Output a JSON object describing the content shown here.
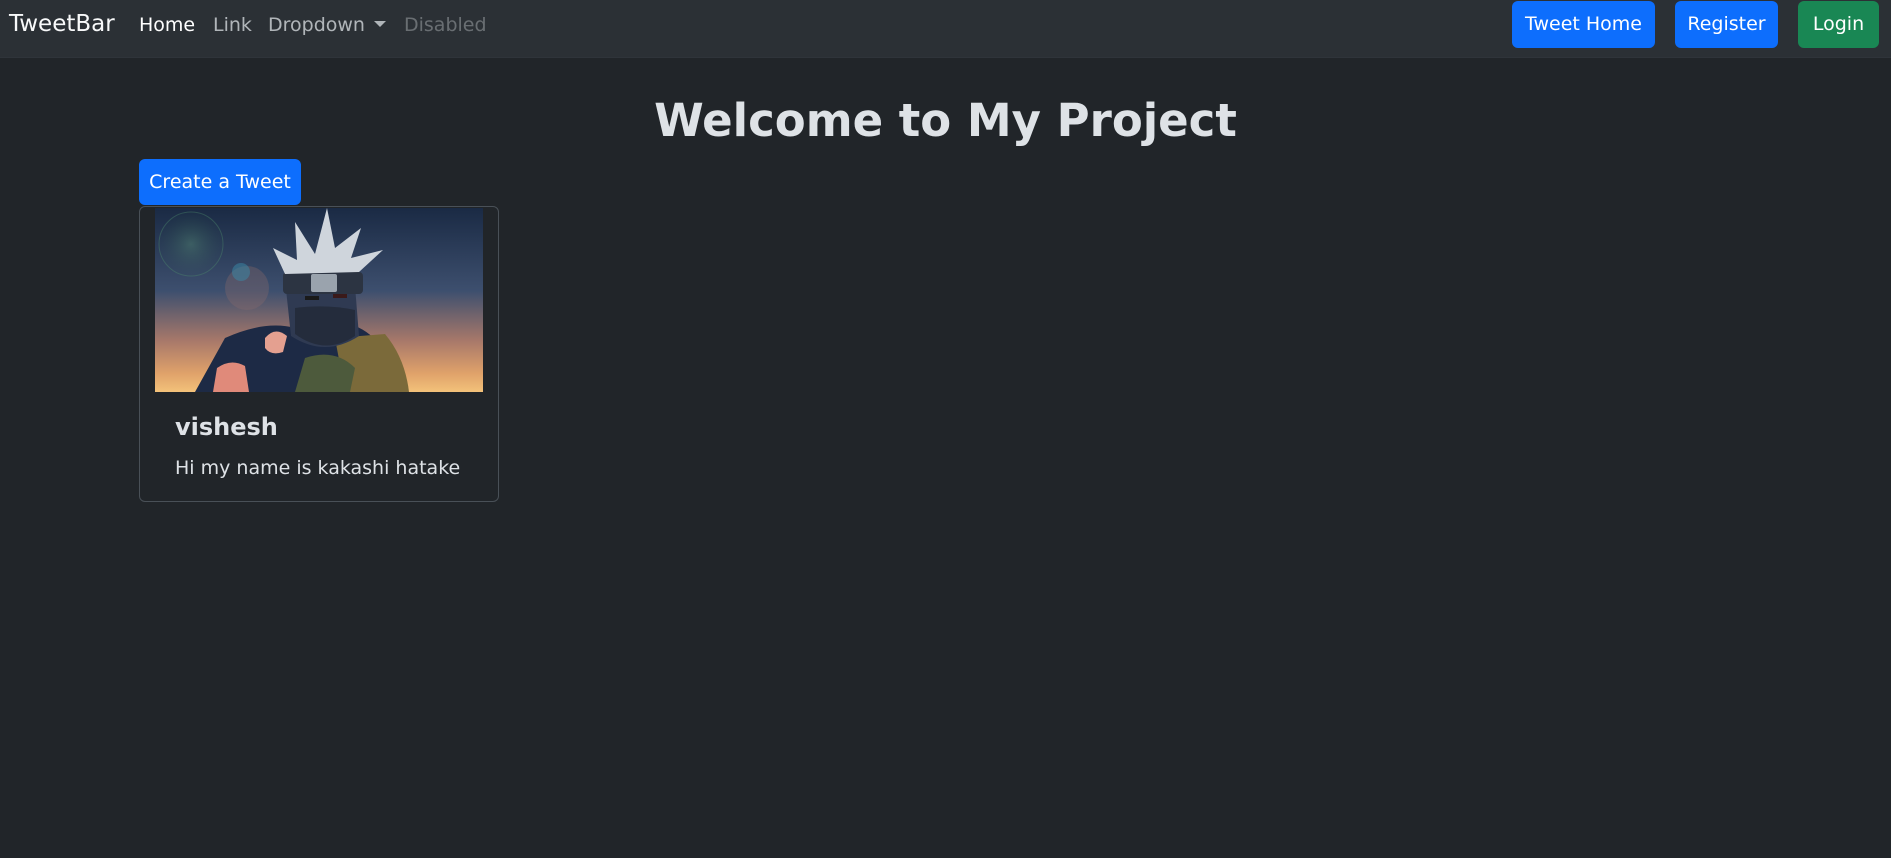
{
  "navbar": {
    "brand": "TweetBar",
    "links": [
      {
        "label": "Home"
      },
      {
        "label": "Link"
      },
      {
        "label": "Dropdown"
      },
      {
        "label": "Disabled"
      }
    ],
    "buttons": {
      "tweet_home": "Tweet Home",
      "register": "Register",
      "login": "Login"
    }
  },
  "main": {
    "title": "Welcome to My Project",
    "create_button": "Create a Tweet",
    "tweets": [
      {
        "author": "vishesh",
        "text": "Hi my name is kakashi hatake",
        "image": "anime-character-image"
      }
    ]
  },
  "colors": {
    "background": "#212529",
    "navbar": "#2b3035",
    "primary": "#0d6efd",
    "success": "#198754"
  }
}
